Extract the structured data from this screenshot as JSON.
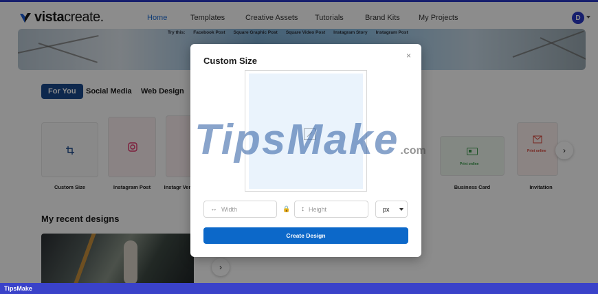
{
  "brand": {
    "logo_bold": "vista",
    "logo_light": "create."
  },
  "nav": {
    "items": [
      {
        "label": "Home",
        "active": true
      },
      {
        "label": "Templates",
        "active": false
      },
      {
        "label": "Creative Assets",
        "active": false
      },
      {
        "label": "Tutorials",
        "active": false
      },
      {
        "label": "Brand Kits",
        "active": false
      },
      {
        "label": "My Projects",
        "active": false
      }
    ],
    "avatar_initial": "D"
  },
  "hero": {
    "try_label": "Try this:",
    "suggestions": [
      "Facebook Post",
      "Square Graphic Post",
      "Square Video Post",
      "Instagram Story",
      "Instagram Post"
    ]
  },
  "categories": [
    {
      "label": "For You",
      "selected": true
    },
    {
      "label": "Social Media",
      "selected": false
    },
    {
      "label": "Web Design",
      "selected": false
    }
  ],
  "templates": [
    {
      "label": "Custom Size"
    },
    {
      "label": "Instagram Post"
    },
    {
      "label": "Instagr Ver"
    },
    {
      "label": "Business Card"
    },
    {
      "label": "Invitation"
    }
  ],
  "template_badges": {
    "business_card": "Print online",
    "invitation": "Print online"
  },
  "recent": {
    "title": "My recent designs"
  },
  "modal": {
    "title": "Custom Size",
    "close_glyph": "×",
    "width_placeholder": "Width",
    "height_placeholder": "Height",
    "unit": "px",
    "create_label": "Create Design"
  },
  "watermark": {
    "main": "TipsMake",
    "suffix": ".com"
  },
  "bottom_bar": {
    "label": "TipsMake"
  },
  "colors": {
    "accent": "#0c68c9",
    "nav_active": "#1e6ed8",
    "category_selected": "#1b4a8c",
    "bottom_bar": "#3a42c9"
  }
}
